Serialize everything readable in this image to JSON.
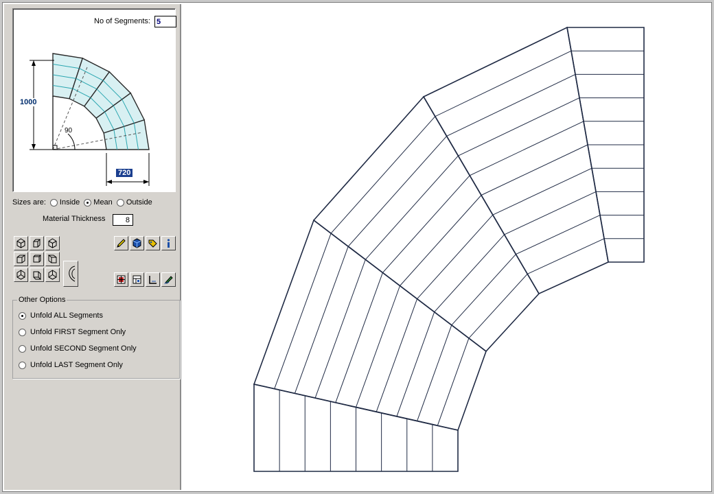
{
  "preview": {
    "segments_label": "No of Segments:",
    "segments_value": "5",
    "dim_height": "1000",
    "dim_width": "720",
    "dim_angle": "90"
  },
  "sizes": {
    "label": "Sizes are:",
    "options": [
      "Inside",
      "Mean",
      "Outside"
    ],
    "selected": "Mean"
  },
  "material": {
    "label": "Material Thickness",
    "value": "8"
  },
  "toolbar": {
    "view_icons": [
      "iso-view-1-icon",
      "iso-view-2-icon",
      "iso-view-3-icon",
      "cube-view-1-icon",
      "cube-view-2-icon",
      "cube-view-3-icon",
      "iso-view-4-icon",
      "iso-view-5-icon",
      "iso-view-6-icon"
    ],
    "action_icons": [
      "pencil-icon",
      "shaded-cube-icon",
      "tag-icon",
      "info-icon",
      "grid-icon",
      "layout-icon",
      "dimension-icon",
      "pen-edit-icon"
    ]
  },
  "other_options": {
    "title": "Other Options",
    "items": [
      "Unfold ALL Segments",
      "Unfold FIRST Segment Only",
      "Unfold SECOND Segment Only",
      "Unfold LAST Segment Only"
    ],
    "selected_index": 0
  },
  "colors": {
    "line": "#1f2a44",
    "preview_fill": "#d8f0f2",
    "preview_teal": "#2aa6b0",
    "preview_dim": "#002e6e"
  }
}
